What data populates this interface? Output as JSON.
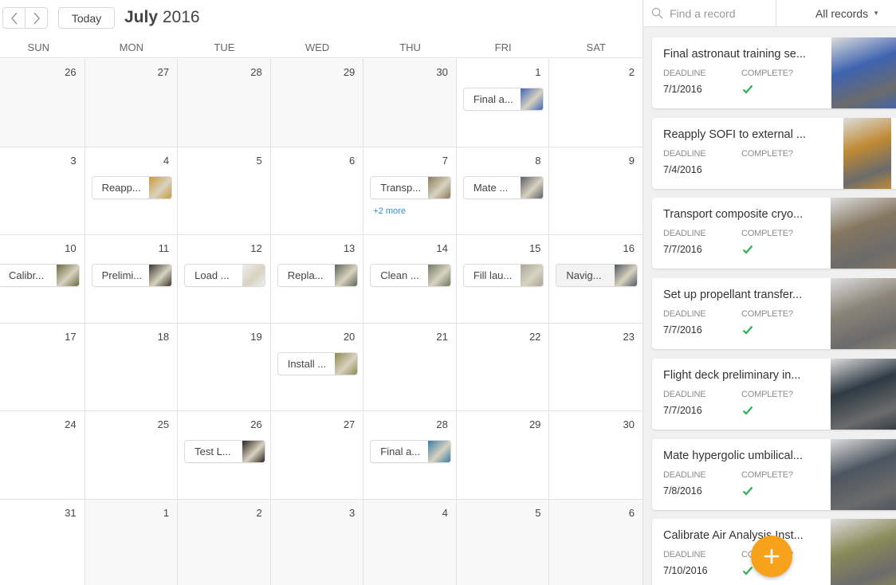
{
  "toolbar": {
    "prev_label": "previous month",
    "next_label": "next month",
    "today_label": "Today",
    "month": "July",
    "year": "2016"
  },
  "weekdays": [
    "SUN",
    "MON",
    "TUE",
    "WED",
    "THU",
    "FRI",
    "SAT"
  ],
  "weeks": [
    [
      {
        "day": "26",
        "other": true
      },
      {
        "day": "27",
        "other": true
      },
      {
        "day": "28",
        "other": true
      },
      {
        "day": "29",
        "other": true
      },
      {
        "day": "30",
        "other": true
      },
      {
        "day": "1",
        "event": {
          "label": "Final a...",
          "thumb": "#3f66b8"
        }
      },
      {
        "day": "2"
      }
    ],
    [
      {
        "day": "3"
      },
      {
        "day": "4",
        "event": {
          "label": "Reapp...",
          "thumb": "#c99a3a"
        }
      },
      {
        "day": "5"
      },
      {
        "day": "6"
      },
      {
        "day": "7",
        "event": {
          "label": "Transp...",
          "thumb": "#8a7a5c"
        },
        "more": "+2 more"
      },
      {
        "day": "8",
        "event": {
          "label": "Mate ...",
          "thumb": "#5a5e66"
        }
      },
      {
        "day": "9"
      }
    ],
    [
      {
        "day": "10",
        "event": {
          "label": "Calibr...",
          "thumb": "#6b6a3e"
        }
      },
      {
        "day": "11",
        "event": {
          "label": "Prelimi...",
          "thumb": "#3b3530"
        }
      },
      {
        "day": "12",
        "event": {
          "label": "Load ...",
          "thumb": "#eceff1"
        }
      },
      {
        "day": "13",
        "event": {
          "label": "Repla...",
          "thumb": "#5d6558"
        }
      },
      {
        "day": "14",
        "event": {
          "label": "Clean ...",
          "thumb": "#6e7b62"
        }
      },
      {
        "day": "15",
        "event": {
          "label": "Fill lau...",
          "thumb": "#a9a79a"
        }
      },
      {
        "day": "16",
        "event": {
          "label": "Navig...",
          "thumb": "#4f5962",
          "hover": true
        }
      }
    ],
    [
      {
        "day": "17"
      },
      {
        "day": "18"
      },
      {
        "day": "19"
      },
      {
        "day": "20",
        "event": {
          "label": "Install ...",
          "thumb": "#8d8a50"
        }
      },
      {
        "day": "21"
      },
      {
        "day": "22"
      },
      {
        "day": "23"
      }
    ],
    [
      {
        "day": "24"
      },
      {
        "day": "25"
      },
      {
        "day": "26",
        "event": {
          "label": "Test L...",
          "thumb": "#2a2320"
        }
      },
      {
        "day": "27"
      },
      {
        "day": "28",
        "event": {
          "label": "Final a...",
          "thumb": "#3a7aa8"
        }
      },
      {
        "day": "29"
      },
      {
        "day": "30"
      }
    ],
    [
      {
        "day": "31"
      },
      {
        "day": "1",
        "other": true
      },
      {
        "day": "2",
        "other": true
      },
      {
        "day": "3",
        "other": true
      },
      {
        "day": "4",
        "other": true
      },
      {
        "day": "5",
        "other": true
      },
      {
        "day": "6",
        "other": true
      }
    ]
  ],
  "sidebar": {
    "search_placeholder": "Find a record",
    "search_value": "",
    "filter_label": "All records",
    "deadline_label": "DEADLINE",
    "complete_label": "COMPLETE?",
    "check_color": "#2bb24c",
    "records": [
      {
        "title": "Final astronaut training se...",
        "deadline": "7/1/2016",
        "complete": true,
        "img": "#3e63b0"
      },
      {
        "title": "Reapply SOFI to external ...",
        "deadline": "7/4/2016",
        "complete": false,
        "img": "#c08a34"
      },
      {
        "title": "Transport composite cryo...",
        "deadline": "7/7/2016",
        "complete": true,
        "img": "#857660"
      },
      {
        "title": "Set up propellant transfer...",
        "deadline": "7/7/2016",
        "complete": true,
        "img": "#8b8478"
      },
      {
        "title": "Flight deck preliminary in...",
        "deadline": "7/7/2016",
        "complete": true,
        "img": "#2e3a44"
      },
      {
        "title": "Mate hypergolic umbilical...",
        "deadline": "7/8/2016",
        "complete": true,
        "img": "#4c5560"
      },
      {
        "title": "Calibrate Air Analysis Inst...",
        "deadline": "7/10/2016",
        "complete": true,
        "img": "#8a8a5a"
      }
    ]
  },
  "fab": {
    "label": "add record",
    "color": "#f7a21b"
  }
}
